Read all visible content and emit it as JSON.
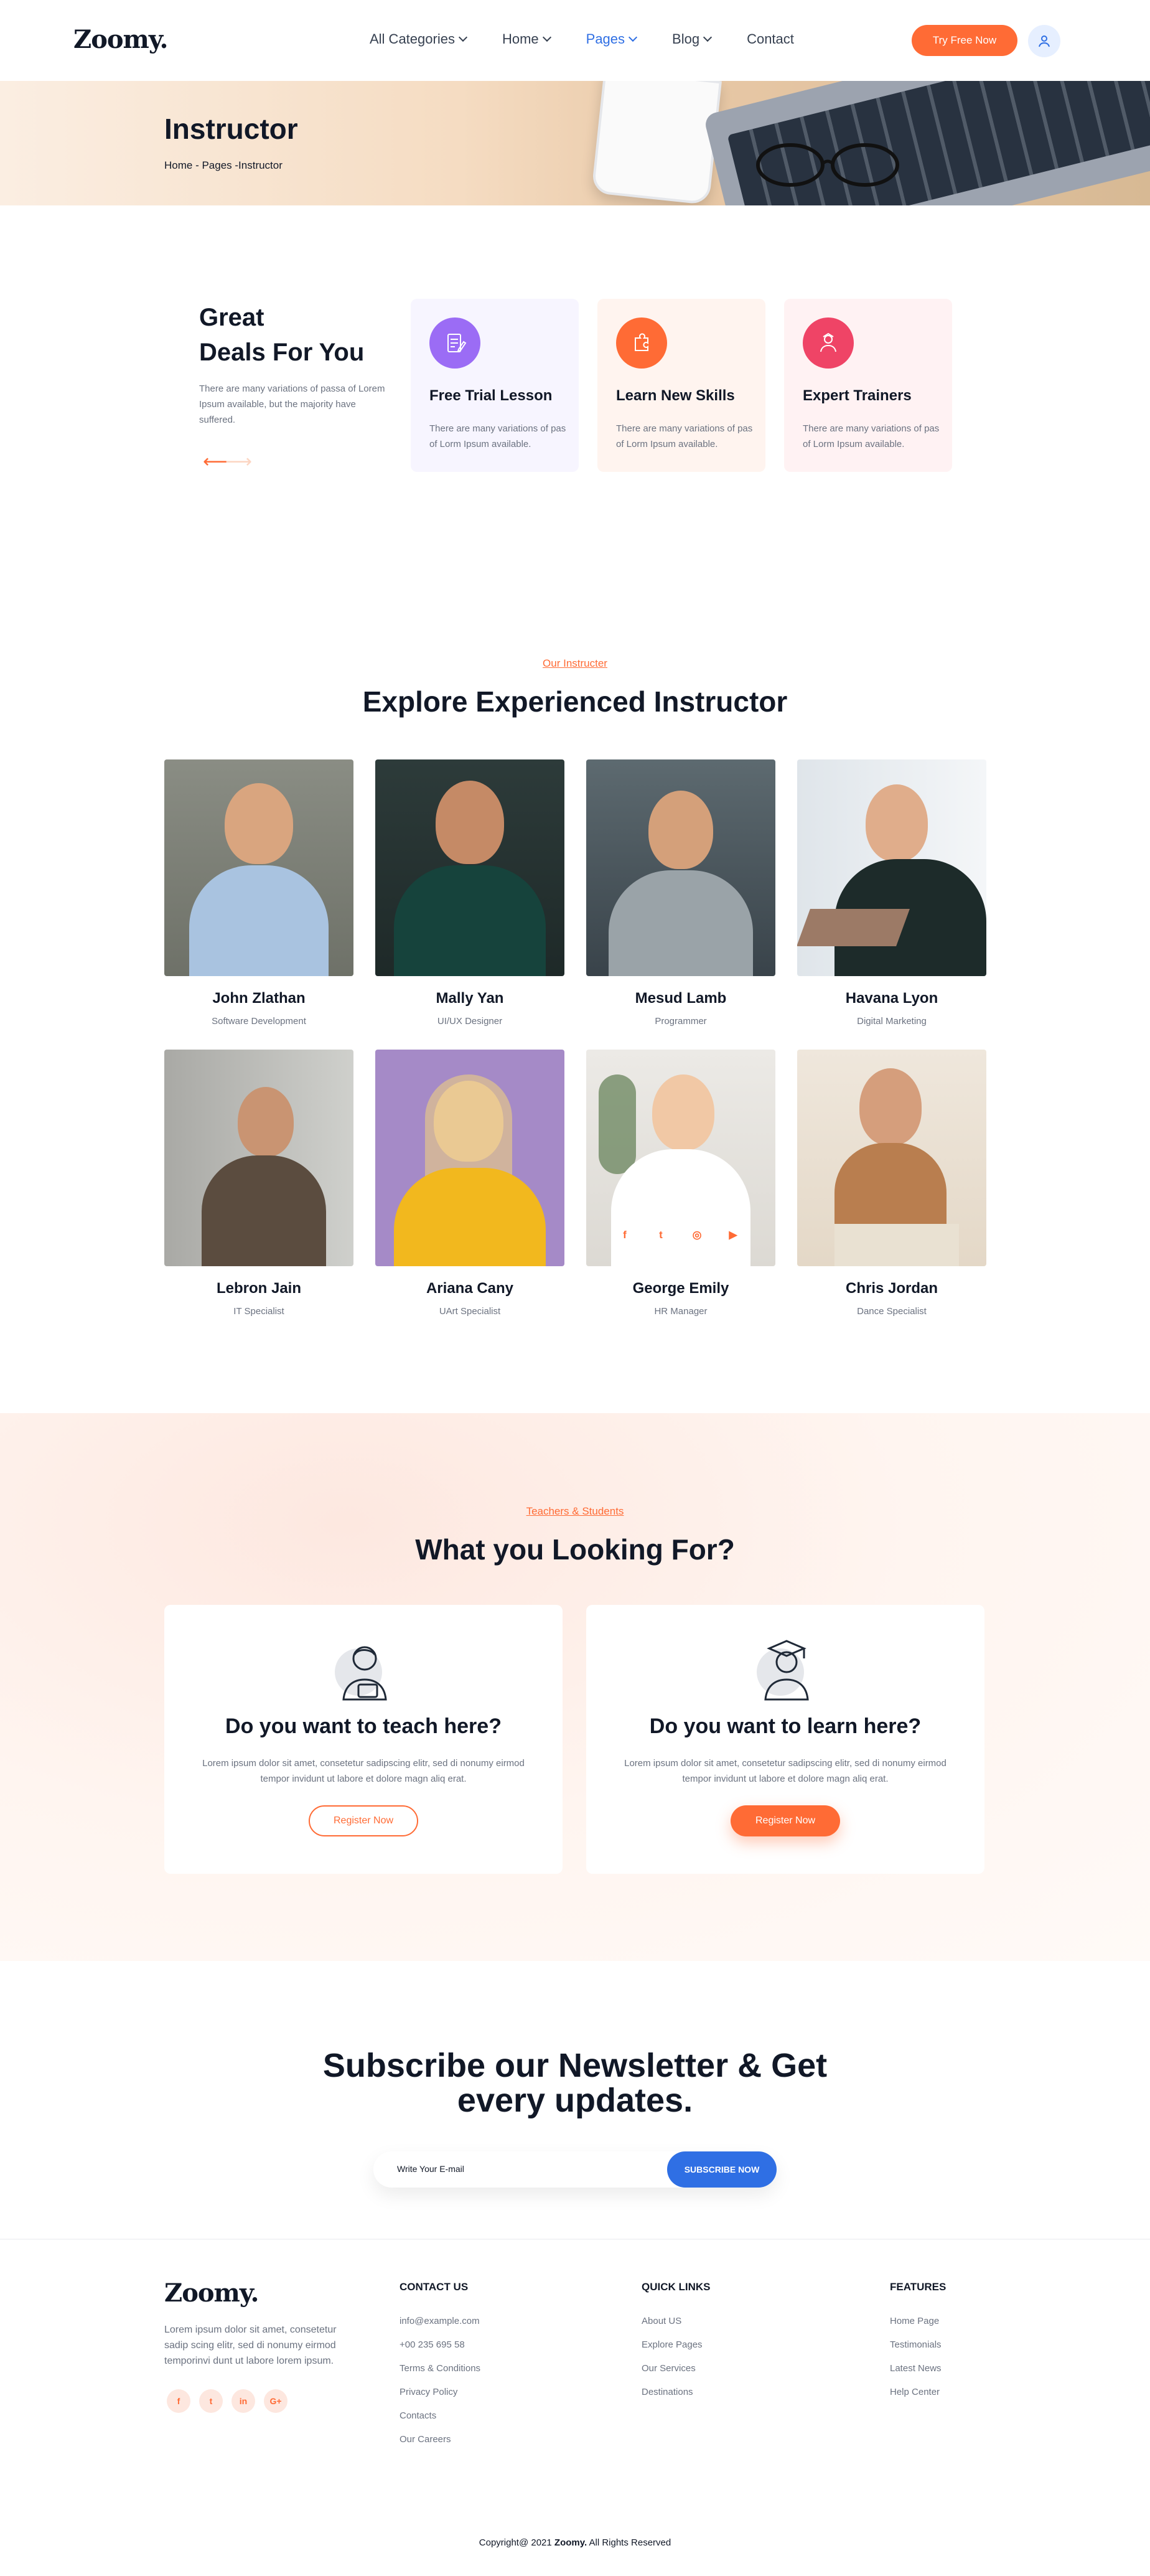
{
  "header": {
    "logo": "Zoomy.",
    "nav": [
      {
        "label": "All Categories",
        "dropdown": true,
        "active": false
      },
      {
        "label": "Home",
        "dropdown": true,
        "active": false
      },
      {
        "label": "Pages",
        "dropdown": true,
        "active": true
      },
      {
        "label": "Blog",
        "dropdown": true,
        "active": false
      },
      {
        "label": "Contact",
        "dropdown": false,
        "active": false
      }
    ],
    "cta": "Try Free Now",
    "accent": "#ff6b35",
    "link_active": "#2f6fe4"
  },
  "hero": {
    "title": "Instructor",
    "breadcrumb": "Home - Pages -Instructor"
  },
  "deals": {
    "title_line1": "Great",
    "title_line2": "Deals For You",
    "text": "There are many variations of passa of Lorem Ipsum available, but the majority have suffered.",
    "cards": [
      {
        "title": "Free Trial Lesson",
        "text": "There are many variations of pas of Lorm Ipsum available.",
        "icon": "document-icon"
      },
      {
        "title": "Learn New Skills",
        "text": "There are many variations of pas of Lorm Ipsum available.",
        "icon": "puzzle-icon"
      },
      {
        "title": "Expert Trainers",
        "text": "There are many variations of pas of Lorm Ipsum available.",
        "icon": "trainer-icon"
      }
    ]
  },
  "instructors": {
    "eyebrow": "Our Instructer",
    "title": "Explore Experienced Instructor",
    "items": [
      {
        "name": "John Zlathan",
        "role": "Software Development"
      },
      {
        "name": "Mally Yan",
        "role": "UI/UX Designer"
      },
      {
        "name": "Mesud Lamb",
        "role": "Programmer"
      },
      {
        "name": "Havana Lyon",
        "role": "Digital Marketing"
      },
      {
        "name": "Lebron Jain",
        "role": "IT Specialist"
      },
      {
        "name": "Ariana Cany",
        "role": "UArt Specialist"
      },
      {
        "name": "George Emily",
        "role": "HR Manager"
      },
      {
        "name": "Chris Jordan",
        "role": "Dance Specialist"
      }
    ],
    "socials": [
      "f",
      "t",
      "ig",
      "yt"
    ]
  },
  "looking": {
    "eyebrow": "Teachers & Students",
    "title": "What you Looking For?",
    "cards": [
      {
        "title": "Do you want to teach here?",
        "text": "Lorem ipsum dolor sit amet, consetetur sadipscing elitr, sed di nonumy eirmod tempor invidunt ut labore et dolore magn aliq erat.",
        "button": "Register Now"
      },
      {
        "title": "Do you want to learn here?",
        "text": "Lorem ipsum dolor sit amet, consetetur sadipscing elitr, sed di nonumy eirmod tempor invidunt ut labore et dolore magn aliq erat.",
        "button": "Register Now"
      }
    ]
  },
  "newsletter": {
    "title_line1": "Subscribe our Newsletter & Get",
    "title_line2": "every updates.",
    "placeholder": "Write Your E-mail",
    "button": "SUBSCRIBE NOW"
  },
  "footer": {
    "logo": "Zoomy.",
    "about": "Lorem ipsum dolor sit amet, consetetur sadip scing elitr, sed di nonumy eirmod temporinvi dunt ut labore lorem ipsum.",
    "socials": [
      "f",
      "t",
      "in",
      "G+"
    ],
    "contact": {
      "heading": "CONTACT US",
      "links": [
        "info@example.com",
        "+00 235 695 58",
        "Terms & Conditions",
        "Privacy Policy",
        "Contacts",
        "Our Careers"
      ]
    },
    "quick": {
      "heading": "QUICK LINKS",
      "links": [
        "About US",
        "Explore Pages",
        "Our Services",
        "Destinations"
      ]
    },
    "features": {
      "heading": "FEATURES",
      "links": [
        "Home Page",
        "Testimonials",
        "Latest News",
        "Help Center"
      ]
    },
    "copyright_prefix": "Copyright@ 2021",
    "copyright_brand": "Zoomy.",
    "copyright_suffix": "All Rights Reserved"
  }
}
